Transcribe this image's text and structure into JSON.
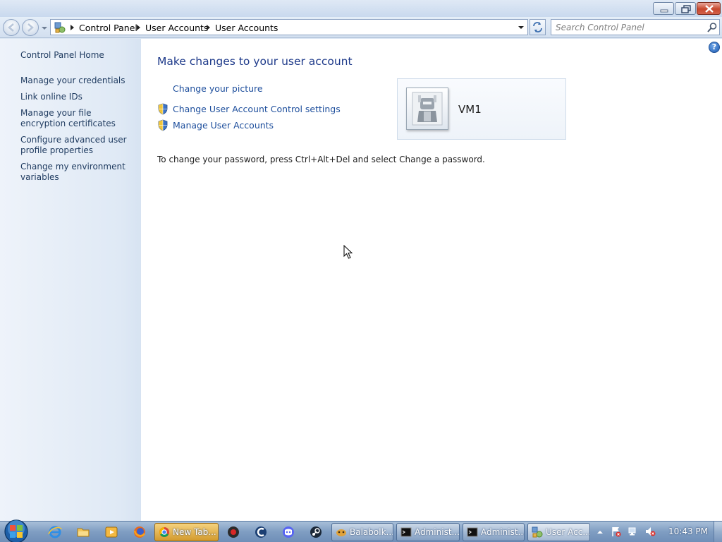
{
  "breadcrumb": {
    "items": [
      "Control Panel",
      "User Accounts",
      "User Accounts"
    ]
  },
  "search": {
    "placeholder": "Search Control Panel"
  },
  "sidebar": {
    "home": "Control Panel Home",
    "items": [
      "Manage your credentials",
      "Link online IDs",
      "Manage your file encryption certificates",
      "Configure advanced user profile properties",
      "Change my environment variables"
    ]
  },
  "main": {
    "title": "Make changes to your user account",
    "tasks": [
      {
        "label": "Change your picture",
        "icon": null
      },
      {
        "label": "Change User Account Control settings",
        "icon": "uac-shield-icon"
      },
      {
        "label": "Manage User Accounts",
        "icon": "uac-shield-icon"
      }
    ],
    "note": "To change your password, press Ctrl+Alt+Del and select Change a password.",
    "user": {
      "name": "VM1"
    },
    "help": "?"
  },
  "taskbar": {
    "buttons": [
      "New Tab...",
      "Balabolk...",
      "Administ...",
      "Administ...",
      "User Acc..."
    ],
    "clock": "10:43 PM"
  },
  "colors": {
    "link": "#1d4e9c",
    "title": "#1e3a8a",
    "sidebar_bg": "#e4ecf7"
  }
}
